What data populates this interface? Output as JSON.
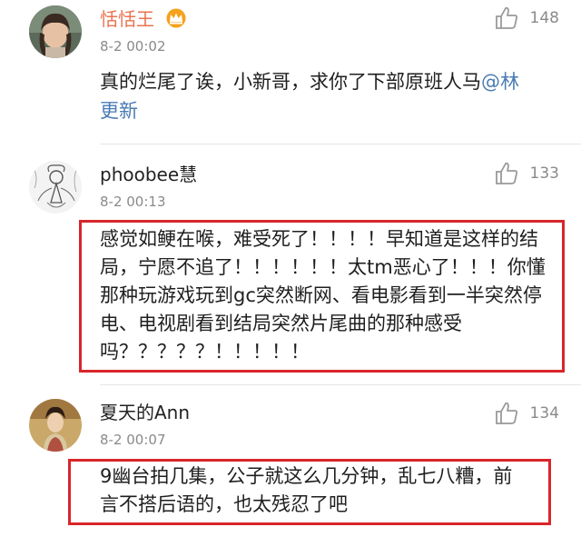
{
  "comments": [
    {
      "username": "恬恬王",
      "vip": true,
      "timestamp": "8-2 00:02",
      "likes": "148",
      "text": "真的烂尾了诶，小新哥，求你了下部原班人马",
      "mention": "@林更新",
      "avatar_icon": "woman-portrait-avatar",
      "crown_icon": "vip-crown-icon"
    },
    {
      "username": "phoobee慧",
      "vip": false,
      "timestamp": "8-2 00:13",
      "likes": "133",
      "text": "感觉如鲠在喉，难受死了！！！！早知道是这样的结局，宁愿不追了！！！！！！太tm恶心了！！！你懂那种玩游戏玩到gc突然断网、看电影看到一半突然停电、电视剧看到结局突然片尾曲的那种感受吗？？？？？！！！！！",
      "avatar_icon": "sketch-figure-avatar"
    },
    {
      "username": "夏天的Ann",
      "vip": false,
      "timestamp": "8-2 00:07",
      "likes": "134",
      "text": "9幽台拍几集，公子就这么几分钟，乱七八糟，前言不搭后语的，也太残忍了吧",
      "avatar_icon": "costume-drama-avatar"
    }
  ],
  "colors": {
    "vip_name": "#eb7350",
    "mention": "#4b7bb3",
    "highlight_border": "#d8262b",
    "meta_gray": "#8a8a8a"
  }
}
